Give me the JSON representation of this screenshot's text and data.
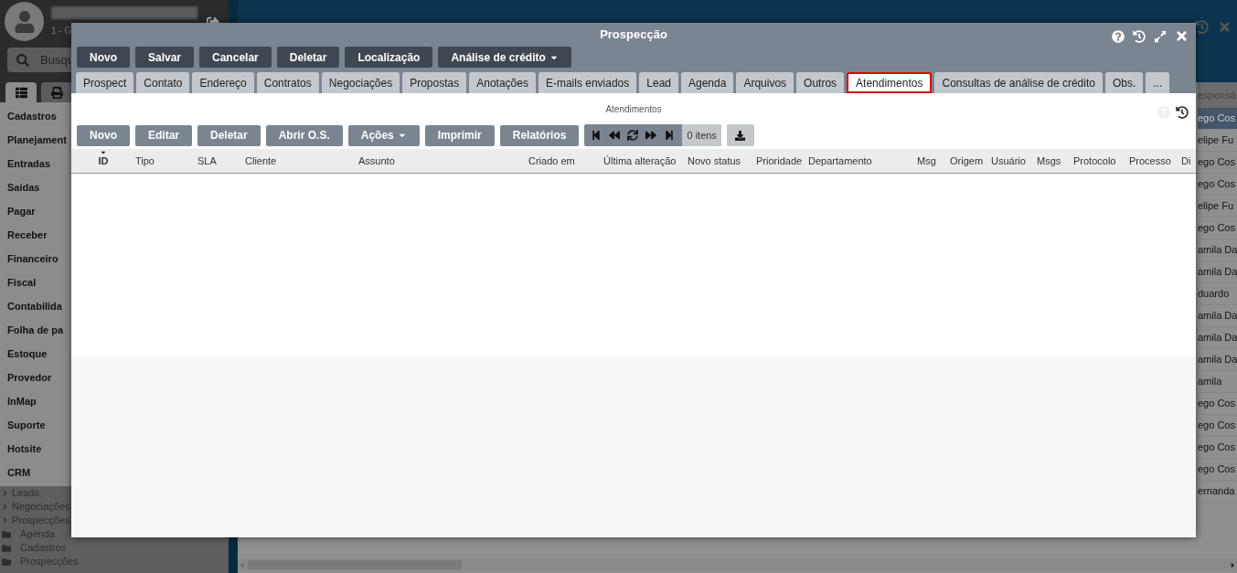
{
  "sidebar": {
    "user_subtitle": "1 - G",
    "search": {
      "placeholder": "Busqu"
    },
    "view_tabs": [
      {
        "kind": "list",
        "selected": true
      },
      {
        "kind": "print",
        "selected": false
      }
    ],
    "menu": [
      "Cadastros",
      "Planejament",
      "Entradas",
      "Saidas",
      "Pagar",
      "Receber",
      "Financeiro",
      "Fiscal",
      "Contabilida",
      "Folha de pa",
      "Estoque",
      "Provedor",
      "InMap",
      "Suporte",
      "Hotsite",
      "CRM"
    ],
    "tree": [
      {
        "kind": "expandable",
        "label": "Leads"
      },
      {
        "kind": "expandable",
        "label": "Negociações"
      },
      {
        "kind": "expandable",
        "label": "Prospecções"
      },
      {
        "kind": "folder",
        "label": "Agenda"
      },
      {
        "kind": "folder",
        "label": "Cadastros"
      },
      {
        "kind": "folder",
        "label": "Prospecções"
      }
    ]
  },
  "background_grid": {
    "column_header": "esponsá",
    "rows": [
      {
        "text": "ego Cos",
        "selected": true
      },
      {
        "text": "elipe Fu",
        "selected": false
      },
      {
        "text": "ego Cos",
        "selected": false
      },
      {
        "text": "ego Cos",
        "selected": false
      },
      {
        "text": "elipe Fu",
        "selected": false
      },
      {
        "text": "ego Cos",
        "selected": false
      },
      {
        "text": "amila Da",
        "selected": false
      },
      {
        "text": "amila Da",
        "selected": false
      },
      {
        "text": "duardo",
        "selected": false
      },
      {
        "text": "amila Da",
        "selected": false
      },
      {
        "text": "amila Da",
        "selected": false
      },
      {
        "text": "amila Da",
        "selected": false
      },
      {
        "text": "amila",
        "selected": false
      },
      {
        "text": "ego Cos",
        "selected": false
      },
      {
        "text": "ego Cos",
        "selected": false
      },
      {
        "text": "ego Cos",
        "selected": false
      },
      {
        "text": "ego Cos",
        "selected": false
      },
      {
        "text": "ernanda",
        "selected": false
      }
    ]
  },
  "dialog": {
    "title": "Prospecção",
    "toolbar": [
      {
        "label": "Novo",
        "dropdown": false
      },
      {
        "label": "Salvar",
        "dropdown": false
      },
      {
        "label": "Cancelar",
        "dropdown": false
      },
      {
        "label": "Deletar",
        "dropdown": false
      },
      {
        "label": "Localização",
        "dropdown": false
      },
      {
        "label": "Análise de crédito",
        "dropdown": true
      }
    ],
    "tabs": [
      {
        "label": "Prospect",
        "selected": false
      },
      {
        "label": "Contato",
        "selected": false
      },
      {
        "label": "Endereço",
        "selected": false
      },
      {
        "label": "Contratos",
        "selected": false
      },
      {
        "label": "Negociações",
        "selected": false
      },
      {
        "label": "Propostas",
        "selected": false
      },
      {
        "label": "Anotações",
        "selected": false
      },
      {
        "label": "E-mails enviados",
        "selected": false
      },
      {
        "label": "Lead",
        "selected": false
      },
      {
        "label": "Agenda",
        "selected": false
      },
      {
        "label": "Arquivos",
        "selected": false
      },
      {
        "label": "Outros",
        "selected": false
      },
      {
        "label": "Atendimentos",
        "selected": true
      },
      {
        "label": "Consultas de análise de crédito",
        "selected": false
      },
      {
        "label": "Obs.",
        "selected": false
      },
      {
        "label": "...",
        "selected": false
      }
    ],
    "panel": {
      "caption": "Atendimentos",
      "buttons": [
        {
          "label": "Novo",
          "dropdown": false
        },
        {
          "label": "Editar",
          "dropdown": false
        },
        {
          "label": "Deletar",
          "dropdown": false
        },
        {
          "label": "Abrir O.S.",
          "dropdown": false
        },
        {
          "label": "Ações",
          "dropdown": true
        },
        {
          "label": "Imprimir",
          "dropdown": false
        },
        {
          "label": "Relatórios",
          "dropdown": false
        }
      ],
      "item_count": "0 itens",
      "columns": [
        {
          "label": "ID",
          "sorted": true
        },
        {
          "label": "Tipo",
          "sorted": false
        },
        {
          "label": "SLA",
          "sorted": false
        },
        {
          "label": "Cliente",
          "sorted": false
        },
        {
          "label": "Assunto",
          "sorted": false
        },
        {
          "label": "Criado em",
          "sorted": false
        },
        {
          "label": "Última alteração",
          "sorted": false
        },
        {
          "label": "Novo status",
          "sorted": false
        },
        {
          "label": "Prioridade",
          "sorted": false
        },
        {
          "label": "Departamento",
          "sorted": false
        },
        {
          "label": "Msg",
          "sorted": false
        },
        {
          "label": "Origem",
          "sorted": false
        },
        {
          "label": "Usuário",
          "sorted": false
        },
        {
          "label": "Msgs",
          "sorted": false
        },
        {
          "label": "Protocolo",
          "sorted": false
        },
        {
          "label": "Processo",
          "sorted": false
        },
        {
          "label": "Di",
          "sorted": false
        }
      ]
    }
  }
}
